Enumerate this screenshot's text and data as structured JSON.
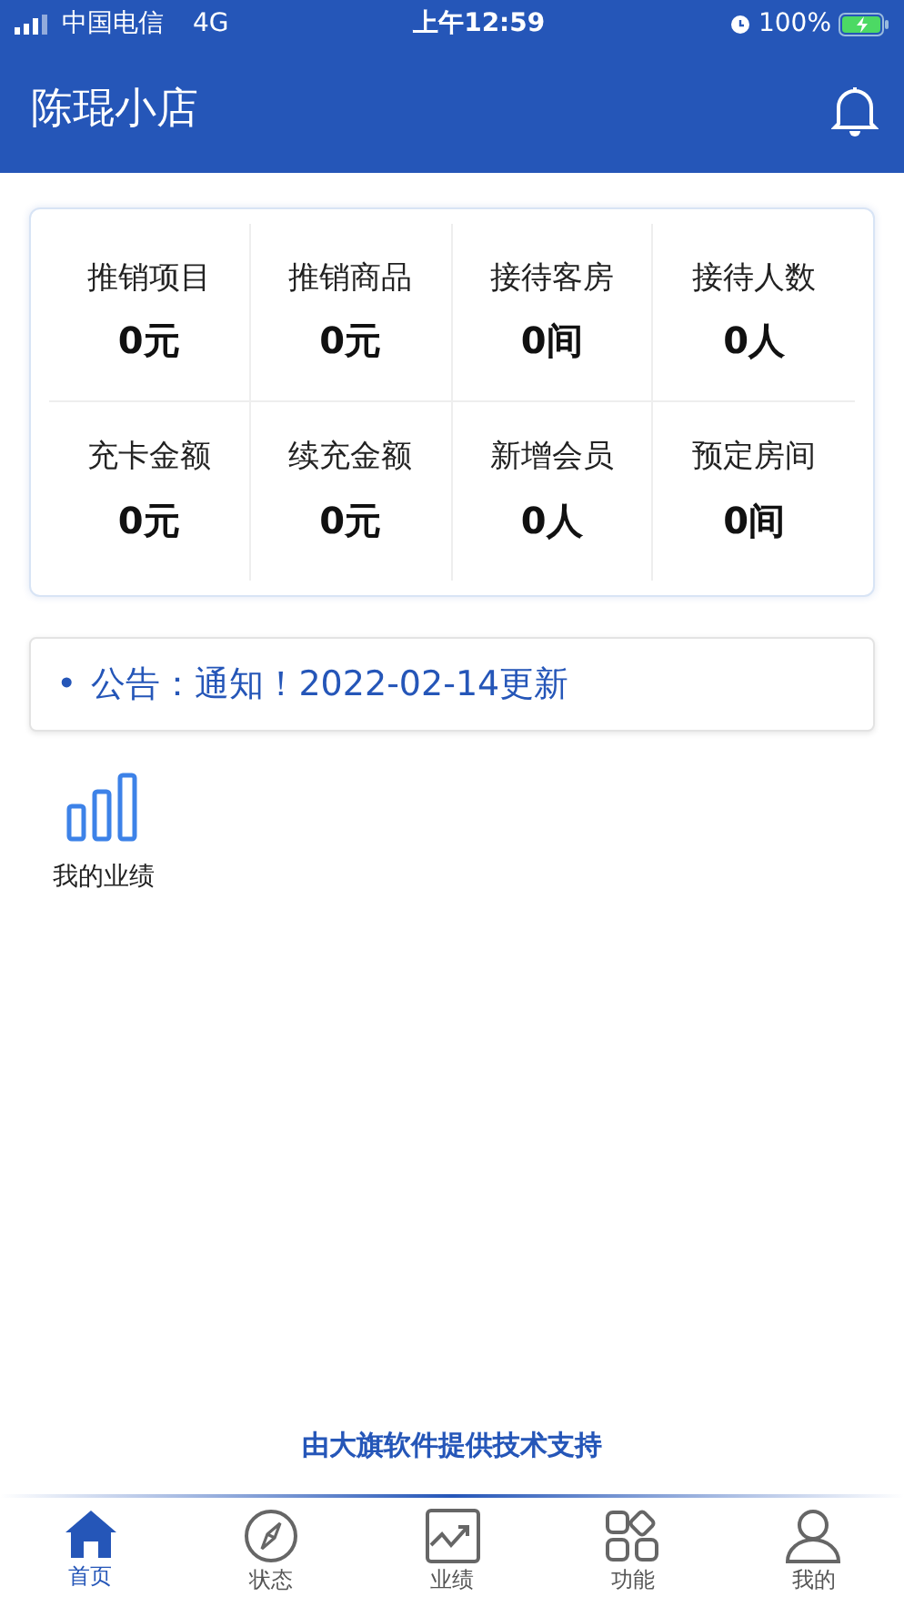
{
  "status_bar": {
    "carrier": "中国电信",
    "network": "4G",
    "time": "上午12:59",
    "battery": "100%"
  },
  "header": {
    "title": "陈琨小店"
  },
  "stats": [
    {
      "label": "推销项目",
      "value": "0元"
    },
    {
      "label": "推销商品",
      "value": "0元"
    },
    {
      "label": "接待客房",
      "value": "0间"
    },
    {
      "label": "接待人数",
      "value": "0人"
    },
    {
      "label": "充卡金额",
      "value": "0元"
    },
    {
      "label": "续充金额",
      "value": "0元"
    },
    {
      "label": "新增会员",
      "value": "0人"
    },
    {
      "label": "预定房间",
      "value": "0间"
    }
  ],
  "notice": {
    "bullet": "•",
    "text": "公告：通知！2022-02-14更新"
  },
  "shortcuts": [
    {
      "label": "我的业绩"
    }
  ],
  "footer": "由大旗软件提供技术支持",
  "tabs": [
    {
      "kind": "home",
      "label": "首页",
      "selected": true
    },
    {
      "kind": "compass",
      "label": "状态",
      "selected": false
    },
    {
      "kind": "chart",
      "label": "业绩",
      "selected": false
    },
    {
      "kind": "apps",
      "label": "功能",
      "selected": false
    },
    {
      "kind": "user",
      "label": "我的",
      "selected": false
    }
  ]
}
